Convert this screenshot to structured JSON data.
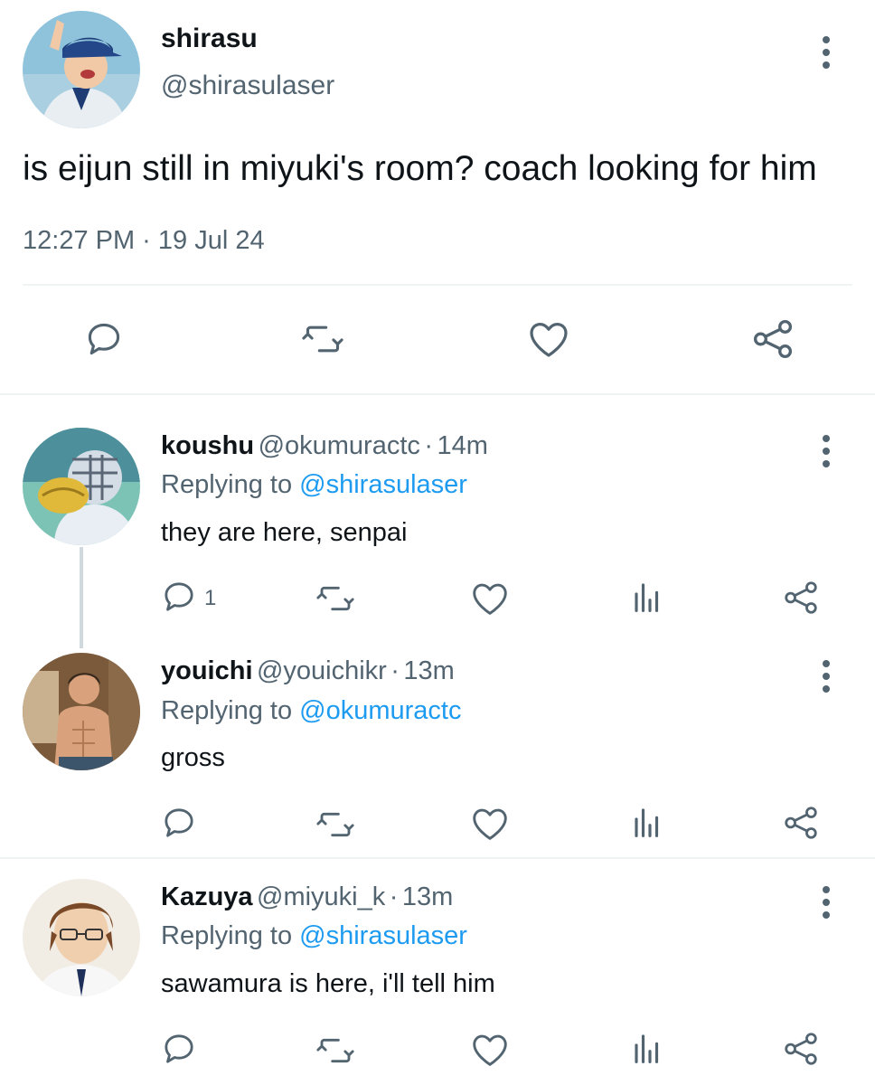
{
  "colors": {
    "text": "#0f1419",
    "secondary": "#536471",
    "accent": "#1d9bf0",
    "divider": "#eff3f4"
  },
  "main_tweet": {
    "display_name": "shirasu",
    "handle": "@shirasulaser",
    "text": "is eijun still in miyuki's room? coach looking for him",
    "timestamp": "12:27 PM · 19 Jul 24",
    "actions": [
      "reply-icon",
      "retweet-icon",
      "like-icon",
      "share-icon"
    ]
  },
  "replies": [
    {
      "display_name": "koushu",
      "handle": "@okumuractc",
      "sep": "·",
      "time": "14m",
      "replying_prefix": "Replying to",
      "replying_to": "@shirasulaser",
      "text": "they are here, senpai",
      "reply_count": "1"
    },
    {
      "display_name": "youichi",
      "handle": "@youichikr",
      "sep": "·",
      "time": "13m",
      "replying_prefix": "Replying to",
      "replying_to": "@okumuractc",
      "text": "gross",
      "reply_count": ""
    },
    {
      "display_name": "Kazuya",
      "handle": "@miyuki_k",
      "sep": "·",
      "time": "13m",
      "replying_prefix": "Replying to",
      "replying_to": "@shirasulaser",
      "text": "sawamura is here, i'll tell him",
      "reply_count": ""
    }
  ]
}
